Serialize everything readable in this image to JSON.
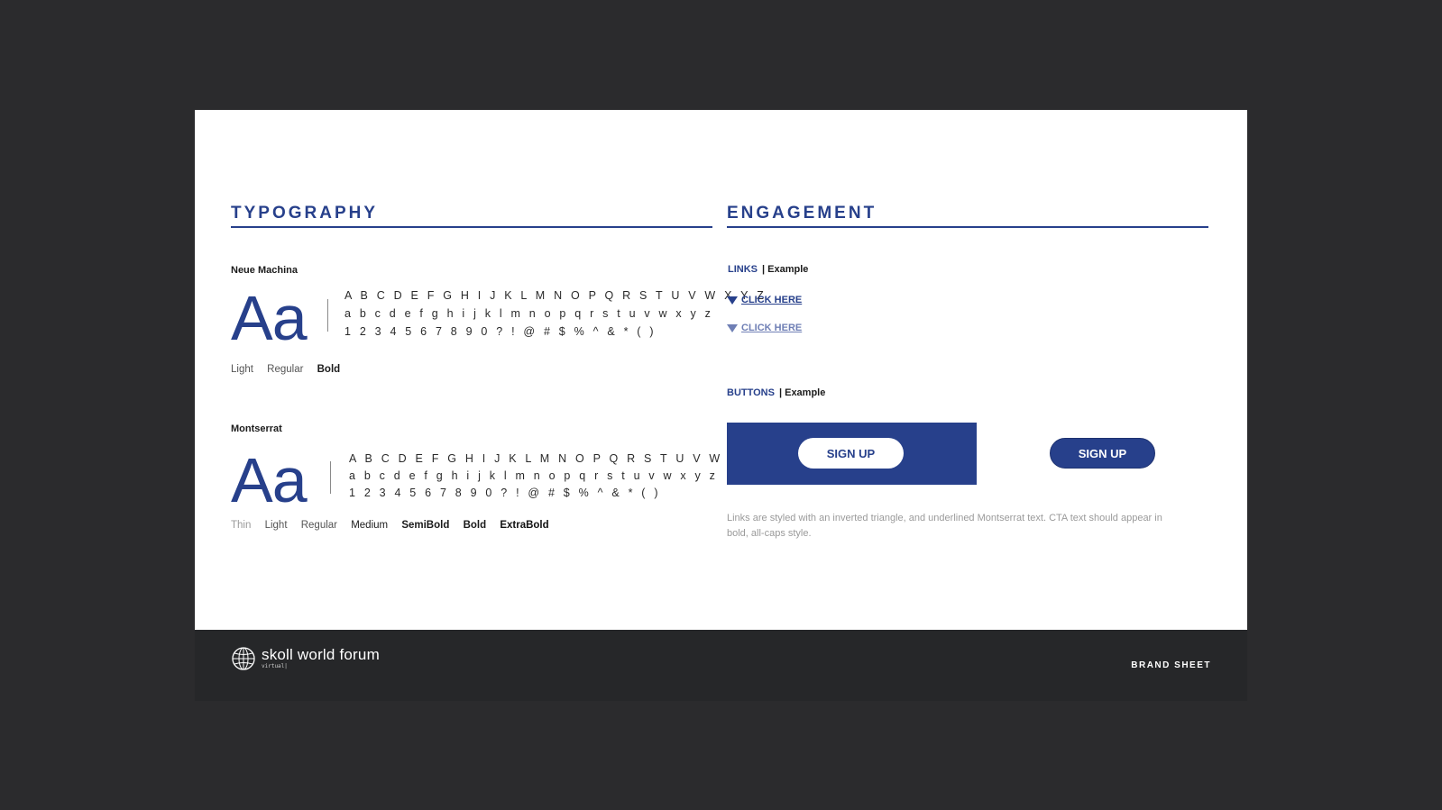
{
  "typography": {
    "title": "TYPOGRAPHY",
    "fonts": [
      {
        "name": "Neue Machina",
        "sample": "Aa",
        "uppercase": "A B C D E F G H I J K L M N O P Q R S T U V W X Y Z",
        "lowercase": "a b c d e f g h i j k l m n o p q r s t u v w x y z",
        "symbols": "1 2 3 4 5 6 7 8 9 0 ? ! @ # $ % ^ & * ( )",
        "weights": [
          "Light",
          "Regular",
          "Bold"
        ]
      },
      {
        "name": "Montserrat",
        "sample": "Aa",
        "uppercase": "A B C D E F G H I J K L M N O P Q R S T U V W X Y Z",
        "lowercase": "a b c d e f g h i j k l m n o p q r s t u v w x y z",
        "symbols": "1 2 3 4 5 6 7 8 9 0 ? ! @ # $ % ^ & * ( )",
        "weights": [
          "Thin",
          "Light",
          "Regular",
          "Medium",
          "SemiBold",
          "Bold",
          "ExtraBold"
        ]
      }
    ]
  },
  "engagement": {
    "title": "ENGAGEMENT",
    "links": {
      "label": "LINKS",
      "example": "| Example",
      "items": [
        "CLICK HERE",
        "CLICK HERE"
      ]
    },
    "buttons": {
      "label": "BUTTONS",
      "example": "| Example",
      "items": [
        "SIGN UP",
        "SIGN UP"
      ]
    },
    "note": "Links are styled with an inverted triangle, and underlined Montserrat text. CTA text should appear in bold, all-caps style."
  },
  "footer": {
    "logo_text": "skoll world forum",
    "logo_sub": "virtual|",
    "right_label": "BRAND SHEET"
  },
  "colors": {
    "brand_blue": "#27408b",
    "link_hover_blue": "#6f7fb5",
    "background": "#2b2b2d",
    "footer": "#262729"
  }
}
